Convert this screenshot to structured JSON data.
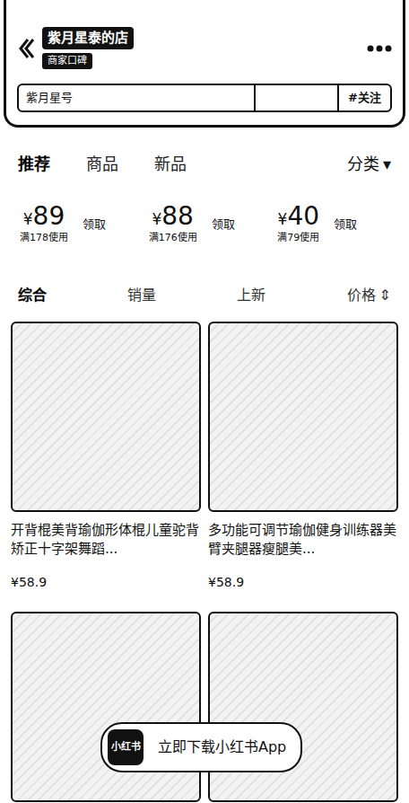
{
  "header": {
    "shop_name": "紫月星泰的店",
    "badge": "商家口碑",
    "search": {
      "placeholder": "紫月星号"
    },
    "follow": "#关注"
  },
  "tabs": [
    {
      "label": "推荐",
      "selected": true
    },
    {
      "label": "商品",
      "selected": false
    },
    {
      "label": "新品",
      "selected": false
    }
  ],
  "category": {
    "label": "分类",
    "arrow": "▾"
  },
  "coupons": [
    {
      "currency": "¥",
      "amount": "89",
      "condition": "满178使用",
      "action": "领取"
    },
    {
      "currency": "¥",
      "amount": "88",
      "condition": "满176使用",
      "action": "领取"
    },
    {
      "currency": "¥",
      "amount": "40",
      "condition": "满79使用",
      "action": "领取"
    }
  ],
  "sort": [
    {
      "label": "综合",
      "selected": true,
      "arrow": ""
    },
    {
      "label": "销量",
      "selected": false,
      "arrow": ""
    },
    {
      "label": "上新",
      "selected": false,
      "arrow": ""
    },
    {
      "label": "价格",
      "selected": false,
      "arrow": "⇕"
    }
  ],
  "products": [
    {
      "title": "开背棍美背瑜伽形体棍儿童驼背矫正十字架舞蹈...",
      "price": "¥58.9"
    },
    {
      "title": "多功能可调节瑜伽健身训练器美臂夹腿器瘦腿美...",
      "price": "¥58.9"
    },
    {
      "title": "",
      "price": ""
    },
    {
      "title": "",
      "price": ""
    }
  ],
  "banner": {
    "logo": "小红书",
    "text": "立即下载小红书App"
  }
}
